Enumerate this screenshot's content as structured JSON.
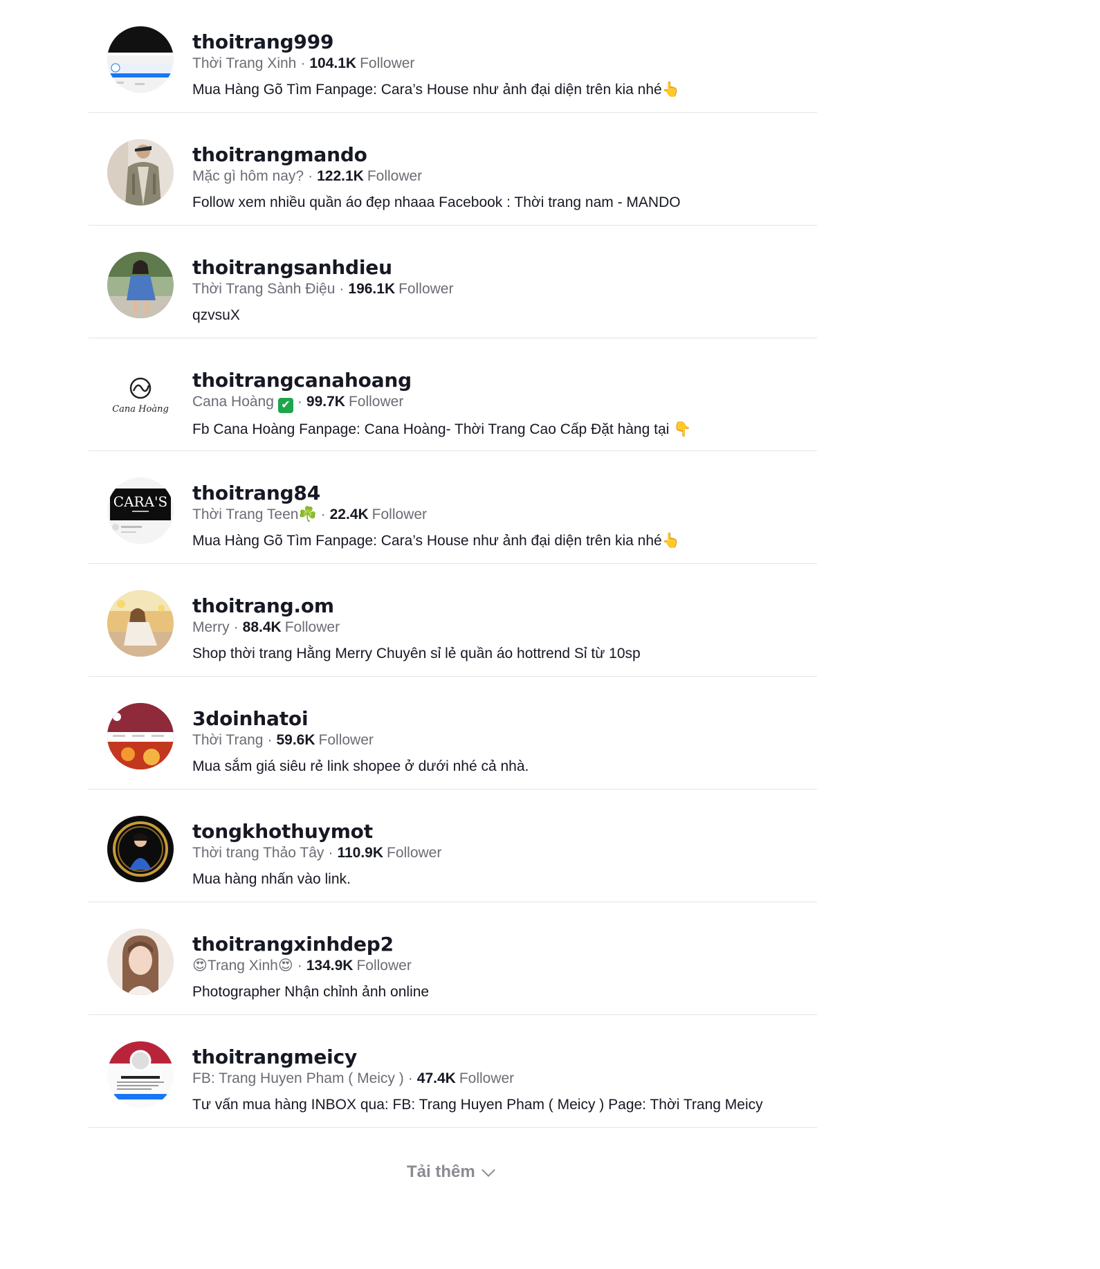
{
  "accounts": [
    {
      "username": "thoitrang999",
      "nickname": "Thời Trang Xinh",
      "followers": "104.1K",
      "follower_label": "Follower",
      "bio": "Mua Hàng Gõ Tìm Fanpage: Cara’s House như ảnh đại diện trên kia nhé👆",
      "avatar_icon": "caras-house-logo-avatar"
    },
    {
      "username": "thoitrangmando",
      "nickname": "Mặc gì hôm nay?",
      "followers": "122.1K",
      "follower_label": "Follower",
      "bio": "Follow xem nhiều quần áo đẹp nhaaa Facebook : Thời trang nam - MANDO",
      "avatar_icon": "man-photo-avatar"
    },
    {
      "username": "thoitrangsanhdieu",
      "nickname": "Thời Trang Sành Điệu",
      "followers": "196.1K",
      "follower_label": "Follower",
      "bio": "qzvsuX",
      "avatar_icon": "woman-outdoor-avatar"
    },
    {
      "username": "thoitrangcanahoang",
      "nickname": "Cana Hoàng",
      "verified_emoji": "✔",
      "followers": "99.7K",
      "follower_label": "Follower",
      "bio": "Fb Cana Hoàng Fanpage: Cana Hoàng- Thời Trang Cao Cấp Đặt hàng tại 👇",
      "avatar_icon": "cana-hoang-logo-avatar",
      "avatar_text": "Cana Hoàng"
    },
    {
      "username": "thoitrang84",
      "nickname": "Thời Trang Teen☘️",
      "followers": "22.4K",
      "follower_label": "Follower",
      "bio": "Mua Hàng Gõ Tìm Fanpage: Cara’s House như ảnh đại diện trên kia nhé👆",
      "avatar_icon": "caras-house-logo-avatar",
      "avatar_text": "CARA'S"
    },
    {
      "username": "thoitrang.om",
      "nickname": "Merry",
      "followers": "88.4K",
      "follower_label": "Follower",
      "bio": "Shop thời trang Hằng Merry Chuyên sỉ lẻ quần áo hottrend Sỉ từ 10sp",
      "avatar_icon": "woman-field-avatar"
    },
    {
      "username": "3doinhatoi",
      "nickname": "Thời Trang",
      "followers": "59.6K",
      "follower_label": "Follower",
      "bio": "Mua sắm giá siêu rẻ link shopee ở dưới nhé cả nhà.",
      "avatar_icon": "red-banner-avatar"
    },
    {
      "username": "tongkhothuymot",
      "nickname": "Thời trang Thảo Tây",
      "followers": "110.9K",
      "follower_label": "Follower",
      "bio": "Mua hàng nhấn vào link.",
      "avatar_icon": "gold-frame-portrait-avatar"
    },
    {
      "username": "thoitrangxinhdep2",
      "nickname": "😍Trang Xinh😍",
      "followers": "134.9K",
      "follower_label": "Follower",
      "bio": "Photographer Nhận chỉnh ảnh online",
      "avatar_icon": "woman-portrait-avatar"
    },
    {
      "username": "thoitrangmeicy",
      "nickname": "FB: Trang Huyen Pham ( Meicy )",
      "followers": "47.4K",
      "follower_label": "Follower",
      "bio": "Tư vấn mua hàng INBOX qua: FB: Trang Huyen Pham ( Meicy ) Page: Thời Trang Meicy",
      "avatar_icon": "facebook-profile-screenshot-avatar"
    }
  ],
  "load_more": {
    "label": "Tải thêm",
    "icon": "chevron-down-icon"
  },
  "colors": {
    "text_primary": "#161823",
    "text_secondary": "#6b6c74",
    "divider": "#e3e3e4",
    "load_more": "#8a8b91"
  }
}
